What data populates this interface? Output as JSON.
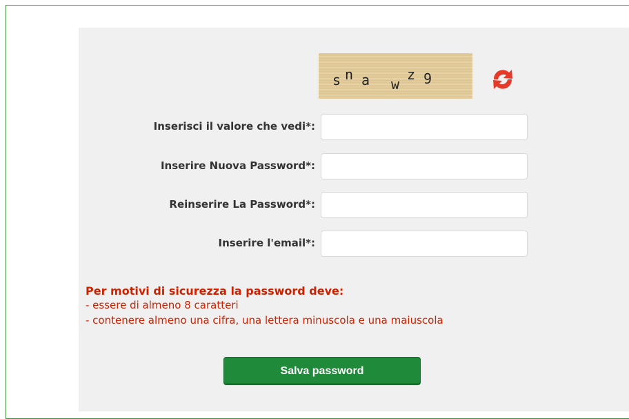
{
  "captcha": {
    "chars": [
      "s",
      "n",
      "a",
      "w",
      "z",
      "9"
    ]
  },
  "refresh": {
    "icon": "refresh-icon",
    "color": "#e53a2a"
  },
  "form": {
    "captcha_label": "Inserisci il valore che vedi*:",
    "new_password_label": "Inserire Nuova Password*:",
    "repeat_password_label": "Reinserire La Password*:",
    "email_label": "Inserire l'email*:"
  },
  "rules": {
    "title": "Per motivi di sicurezza la password deve:",
    "items": [
      "- essere di almeno 8 caratteri",
      "- contenere almeno una cifra, una lettera minuscola e una maiuscola"
    ]
  },
  "save_button": {
    "label": "Salva password",
    "color": "#1f8a3a"
  },
  "colors": {
    "border": "#3a8a3a",
    "warning": "#cc2200"
  }
}
